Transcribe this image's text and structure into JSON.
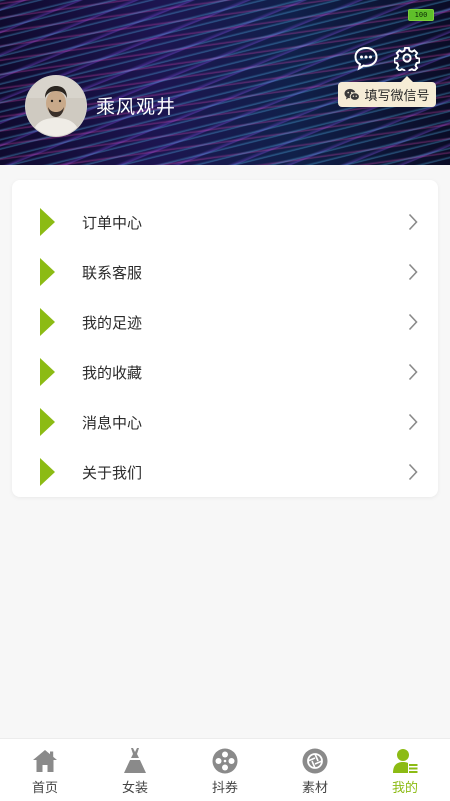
{
  "status_bar": {
    "battery": "100"
  },
  "header": {
    "username": "乘风观井",
    "wechat_tip": "填写微信号",
    "icons": [
      "message-icon",
      "settings-icon",
      "wechat-icon"
    ]
  },
  "menu": {
    "items": [
      {
        "label": "订单中心"
      },
      {
        "label": "联系客服"
      },
      {
        "label": "我的足迹"
      },
      {
        "label": "我的收藏"
      },
      {
        "label": "消息中心"
      },
      {
        "label": "关于我们"
      }
    ]
  },
  "tabbar": {
    "active": "我的",
    "tabs": [
      {
        "label": "首页",
        "icon": "home-icon"
      },
      {
        "label": "女装",
        "icon": "dress-icon"
      },
      {
        "label": "抖券",
        "icon": "film-reel-icon"
      },
      {
        "label": "素材",
        "icon": "aperture-icon"
      },
      {
        "label": "我的",
        "icon": "user-icon"
      }
    ]
  },
  "colors": {
    "accent": "#8cbb14",
    "tab_icon": "#8a8a8a"
  }
}
